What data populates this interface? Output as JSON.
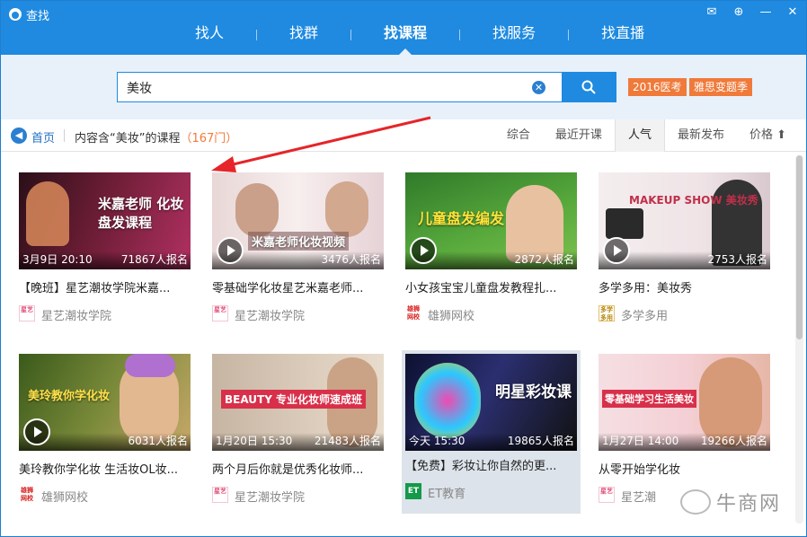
{
  "window": {
    "title": "查找"
  },
  "nav": {
    "items": [
      {
        "label": "找人"
      },
      {
        "label": "找群"
      },
      {
        "label": "找课程",
        "active": true
      },
      {
        "label": "找服务"
      },
      {
        "label": "找直播"
      }
    ]
  },
  "search": {
    "value": "美妆"
  },
  "hot_tags": [
    "2016医考",
    "雅思变题季"
  ],
  "breadcrumb": {
    "home": "首页",
    "result_prefix": "内容含“美妆”的课程",
    "result_count": "（167门）"
  },
  "sort_tabs": [
    {
      "label": "综合"
    },
    {
      "label": "最近开课"
    },
    {
      "label": "人气",
      "active": true
    },
    {
      "label": "最新发布"
    },
    {
      "label": "价格 ⬆"
    }
  ],
  "courses": [
    {
      "thumb_text": "米嘉老师 化妆盘发课程",
      "date": "3月9日 20:10",
      "count": "71867人报名",
      "title": "【晚班】星艺潮妆学院米嘉...",
      "provider": "星艺潮妆学院",
      "logo": "xy",
      "play": false
    },
    {
      "thumb_text": "米嘉老师化妆视频",
      "date": "",
      "count": "3476人报名",
      "title": "零基础学化妆星艺米嘉老师...",
      "provider": "星艺潮妆学院",
      "logo": "xy",
      "play": true
    },
    {
      "thumb_text": "儿童盘发编发",
      "date": "",
      "count": "2872人报名",
      "title": "小女孩宝宝儿童盘发教程扎...",
      "provider": "雄狮网校",
      "logo": "xs",
      "play": true
    },
    {
      "thumb_text": "MAKEUP SHOW 美妆秀",
      "date": "",
      "count": "2753人报名",
      "title": "多学多用：美妆秀",
      "provider": "多学多用",
      "logo": "dx",
      "play": true
    },
    {
      "thumb_text": "美玲教你学化妆",
      "date": "",
      "count": "6031人报名",
      "title": "美玲教你学化妆 生活妆OL妆...",
      "provider": "雄狮网校",
      "logo": "xs",
      "play": true
    },
    {
      "thumb_text": "BEAUTY 专业化妆师速成班",
      "date": "1月20日 15:30",
      "count": "21483人报名",
      "title": "两个月后你就是优秀化妆师...",
      "provider": "星艺潮妆学院",
      "logo": "xy",
      "play": false
    },
    {
      "thumb_text": "明星彩妆课",
      "date": "今天 15:30",
      "count": "19865人报名",
      "title": "【免费】彩妆让你自然的更...",
      "provider": "ET教育",
      "logo": "et",
      "play": false,
      "hover": true
    },
    {
      "thumb_text": "零基础学习生活美妆",
      "date": "1月27日 14:00",
      "count": "19266人报名",
      "title": "从零开始学化妆",
      "provider": "星艺潮",
      "logo": "xy",
      "play": false
    }
  ],
  "watermark": "牛商网"
}
